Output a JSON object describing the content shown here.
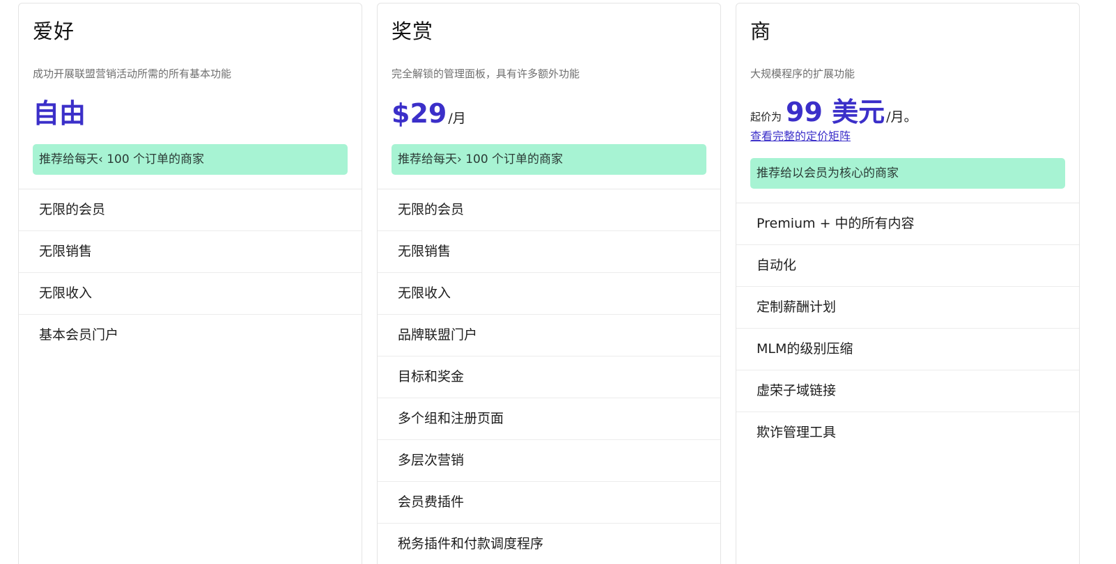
{
  "plans": [
    {
      "name": "爱好",
      "description": "成功开展联盟营销活动所需的所有基本功能",
      "price_prefix": "",
      "price": "自由",
      "price_suffix": "",
      "link": "",
      "recommend": "推荐给每天‹ 100 个订单的商家",
      "features": [
        "无限的会员",
        "无限销售",
        "无限收入",
        "基本会员门户"
      ]
    },
    {
      "name": "奖赏",
      "description": "完全解锁的管理面板，具有许多额外功能",
      "price_prefix": "",
      "price": "$29",
      "price_suffix": "/月",
      "link": "",
      "recommend": "推荐给每天› 100 个订单的商家",
      "features": [
        "无限的会员",
        "无限销售",
        "无限收入",
        "品牌联盟门户",
        "目标和奖金",
        "多个组和注册页面",
        "多层次营销",
        "会员费插件",
        "税务插件和付款调度程序"
      ]
    },
    {
      "name": "商",
      "description": "大规模程序的扩展功能",
      "price_prefix": "起价为",
      "price": "99 美元",
      "price_suffix": "/月。",
      "link": "查看完整的定价矩阵",
      "recommend": "推荐给以会员为核心的商家",
      "features": [
        "Premium + 中的所有内容",
        "自动化",
        "定制薪酬计划",
        "MLM的级别压缩",
        "虚荣子域链接",
        "欺诈管理工具"
      ]
    }
  ]
}
